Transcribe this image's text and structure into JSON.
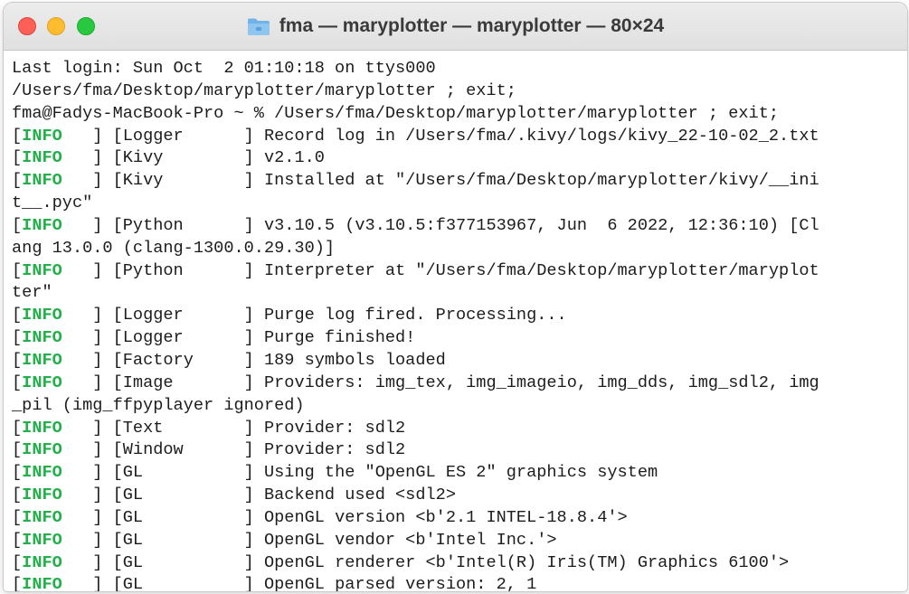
{
  "window": {
    "title": "fma — maryplotter — maryplotter — 80×24",
    "title_icon": "folder-icon"
  },
  "colors": {
    "info_level": "#23b04a",
    "close": "#fe5f57",
    "minimize": "#febc2e",
    "maximize": "#28c840"
  },
  "terminal": {
    "lines": [
      {
        "text": "Last login: Sun Oct  2 01:10:18 on ttys000"
      },
      {
        "text": "/Users/fma/Desktop/maryplotter/maryplotter ; exit;"
      },
      {
        "text": "fma@Fadys-MacBook-Pro ~ % /Users/fma/Desktop/maryplotter/maryplotter ; exit;"
      },
      {
        "pre": "[",
        "level": "INFO",
        "post": "   ] [Logger      ] Record log in /Users/fma/.kivy/logs/kivy_22-10-02_2.txt"
      },
      {
        "pre": "[",
        "level": "INFO",
        "post": "   ] [Kivy        ] v2.1.0"
      },
      {
        "pre": "[",
        "level": "INFO",
        "post": "   ] [Kivy        ] Installed at \"/Users/fma/Desktop/maryplotter/kivy/__ini"
      },
      {
        "text": "t__.pyc\""
      },
      {
        "pre": "[",
        "level": "INFO",
        "post": "   ] [Python      ] v3.10.5 (v3.10.5:f377153967, Jun  6 2022, 12:36:10) [Cl"
      },
      {
        "text": "ang 13.0.0 (clang-1300.0.29.30)]"
      },
      {
        "pre": "[",
        "level": "INFO",
        "post": "   ] [Python      ] Interpreter at \"/Users/fma/Desktop/maryplotter/maryplot"
      },
      {
        "text": "ter\""
      },
      {
        "pre": "[",
        "level": "INFO",
        "post": "   ] [Logger      ] Purge log fired. Processing..."
      },
      {
        "pre": "[",
        "level": "INFO",
        "post": "   ] [Logger      ] Purge finished!"
      },
      {
        "pre": "[",
        "level": "INFO",
        "post": "   ] [Factory     ] 189 symbols loaded"
      },
      {
        "pre": "[",
        "level": "INFO",
        "post": "   ] [Image       ] Providers: img_tex, img_imageio, img_dds, img_sdl2, img"
      },
      {
        "text": "_pil (img_ffpyplayer ignored)"
      },
      {
        "pre": "[",
        "level": "INFO",
        "post": "   ] [Text        ] Provider: sdl2"
      },
      {
        "pre": "[",
        "level": "INFO",
        "post": "   ] [Window      ] Provider: sdl2"
      },
      {
        "pre": "[",
        "level": "INFO",
        "post": "   ] [GL          ] Using the \"OpenGL ES 2\" graphics system"
      },
      {
        "pre": "[",
        "level": "INFO",
        "post": "   ] [GL          ] Backend used <sdl2>"
      },
      {
        "pre": "[",
        "level": "INFO",
        "post": "   ] [GL          ] OpenGL version <b'2.1 INTEL-18.8.4'>"
      },
      {
        "pre": "[",
        "level": "INFO",
        "post": "   ] [GL          ] OpenGL vendor <b'Intel Inc.'>"
      },
      {
        "pre": "[",
        "level": "INFO",
        "post": "   ] [GL          ] OpenGL renderer <b'Intel(R) Iris(TM) Graphics 6100'>"
      },
      {
        "pre": "[",
        "level": "INFO",
        "post": "   ] [GL          ] OpenGL parsed version: 2, 1"
      }
    ]
  }
}
